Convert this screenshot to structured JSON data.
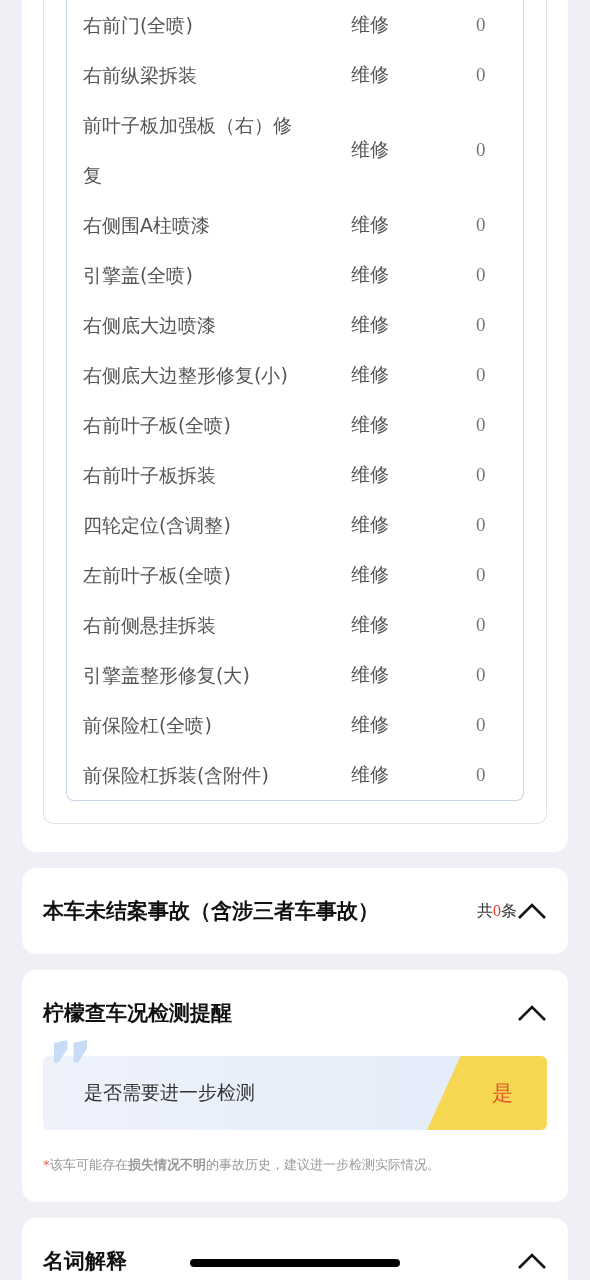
{
  "repair_items": [
    {
      "name": "右前门(全喷)",
      "type": "维修",
      "amount": "0"
    },
    {
      "name": "右前纵梁拆装",
      "type": "维修",
      "amount": "0"
    },
    {
      "name": "前叶子板加强板（右）修复",
      "type": "维修",
      "amount": "0"
    },
    {
      "name": "右侧围A柱喷漆",
      "type": "维修",
      "amount": "0"
    },
    {
      "name": "引擎盖(全喷)",
      "type": "维修",
      "amount": "0"
    },
    {
      "name": "右侧底大边喷漆",
      "type": "维修",
      "amount": "0"
    },
    {
      "name": "右侧底大边整形修复(小)",
      "type": "维修",
      "amount": "0"
    },
    {
      "name": "右前叶子板(全喷)",
      "type": "维修",
      "amount": "0"
    },
    {
      "name": "右前叶子板拆装",
      "type": "维修",
      "amount": "0"
    },
    {
      "name": "四轮定位(含调整)",
      "type": "维修",
      "amount": "0"
    },
    {
      "name": "左前叶子板(全喷)",
      "type": "维修",
      "amount": "0"
    },
    {
      "name": "右前侧悬挂拆装",
      "type": "维修",
      "amount": "0"
    },
    {
      "name": "引擎盖整形修复(大)",
      "type": "维修",
      "amount": "0"
    },
    {
      "name": "前保险杠(全喷)",
      "type": "维修",
      "amount": "0"
    },
    {
      "name": "前保险杠拆装(含附件)",
      "type": "维修",
      "amount": "0"
    }
  ],
  "sections": [
    {
      "kind": "count",
      "title": "本车未结案事故（含涉三者车事故）",
      "expanded": true,
      "count_prefix": "共",
      "count": "0",
      "count_suffix": "条"
    },
    {
      "kind": "check",
      "title": "柠檬查车况检测提醒",
      "expanded": true,
      "question": "是否需要进一步检测",
      "answer": "是",
      "note_mark": "*",
      "note": "该车可能存在**损失情况不明**的事故历史，建议进一步检测实际情况。"
    },
    {
      "kind": "plain",
      "title": "名词解释",
      "expanded": true
    }
  ]
}
